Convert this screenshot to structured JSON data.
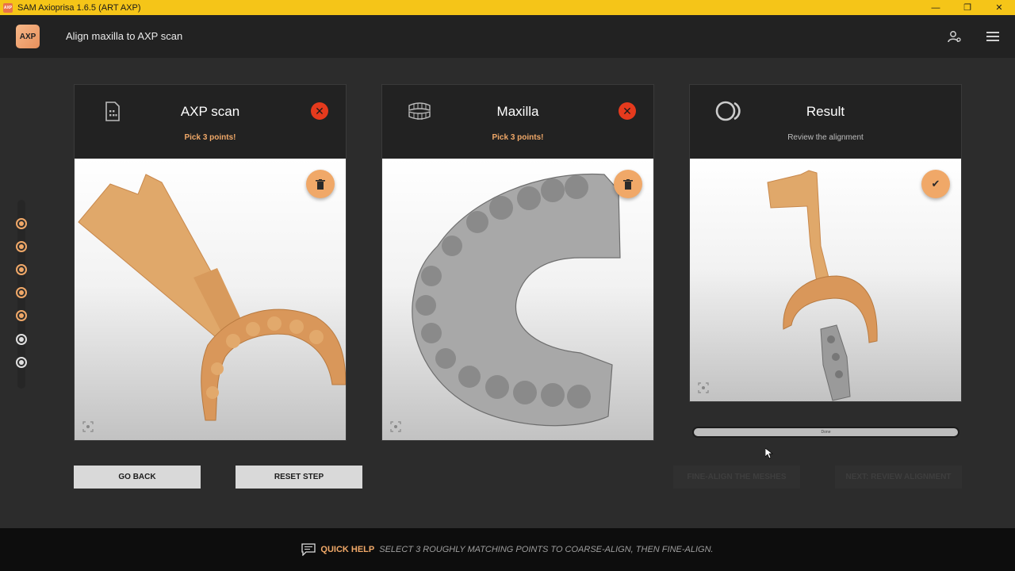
{
  "window": {
    "title": "SAM Axioprisa 1.6.5 (ART AXP)",
    "app_icon": "AXP"
  },
  "header": {
    "logo": "AXP",
    "title": "Align maxilla to AXP scan"
  },
  "stepper": {
    "total_steps": 7,
    "completed_steps": 5
  },
  "panels": {
    "axp": {
      "title": "AXP scan",
      "subtitle": "Pick 3 points!"
    },
    "maxilla": {
      "title": "Maxilla",
      "subtitle": "Pick 3 points!"
    },
    "result": {
      "title": "Result",
      "subtitle": "Review the alignment"
    }
  },
  "progress": {
    "label": "Done",
    "value": 1.0
  },
  "buttons": {
    "go_back": "GO BACK",
    "reset_step": "RESET STEP",
    "fine_align": "FINE-ALIGN THE MESHES",
    "next": "NEXT: REVIEW ALIGNMENT"
  },
  "footer": {
    "label": "QUICK HELP",
    "text": "Select 3 roughly matching points to coarse-align, then fine-align."
  },
  "colors": {
    "accent": "#f0a868",
    "titlebar": "#f5c518",
    "close": "#e53a1d"
  }
}
